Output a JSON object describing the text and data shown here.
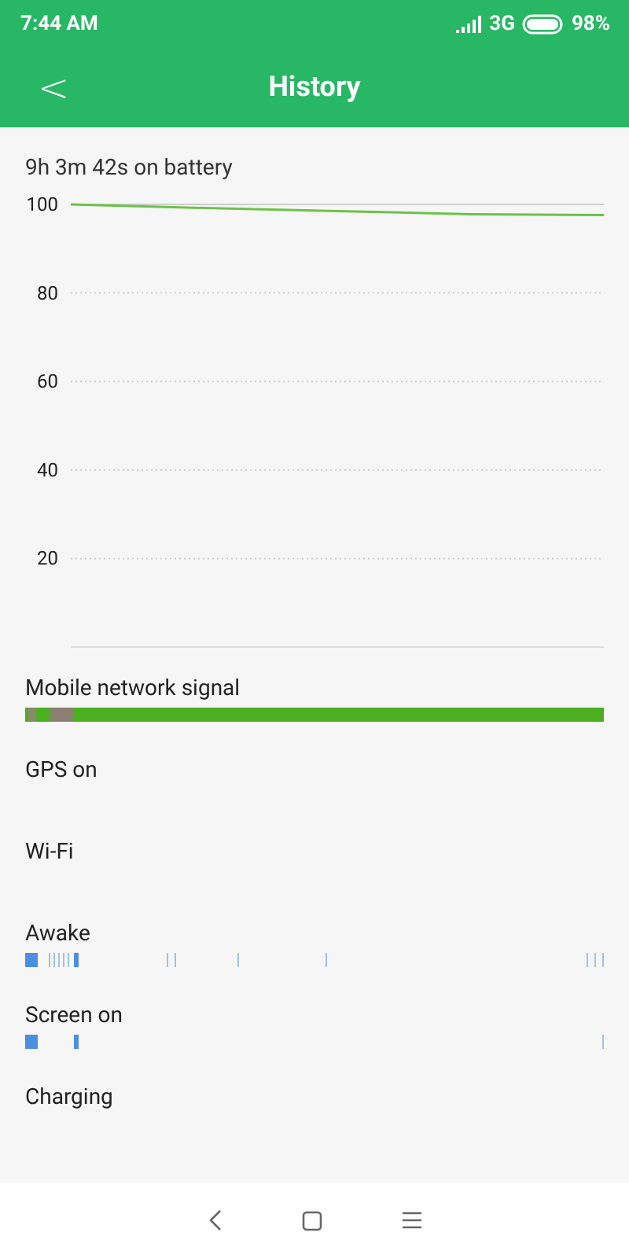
{
  "status_bar": {
    "time": "7:44 AM",
    "network": "3G",
    "battery": "98%"
  },
  "header": {
    "back": "<",
    "title": "History"
  },
  "summary": "9h 3m 42s on battery",
  "chart_data": {
    "type": "line",
    "grid": true,
    "ylim": [
      0,
      100
    ],
    "yticks": [
      100,
      80,
      60,
      40,
      20
    ],
    "series": [
      {
        "color": "#6cc24a",
        "values": [
          100,
          99.2,
          98.5,
          97.8,
          97.6
        ]
      }
    ]
  },
  "rows": [
    {
      "label": "Mobile network signal",
      "kind": "signal"
    },
    {
      "label": "GPS on",
      "kind": "empty"
    },
    {
      "label": "Wi-Fi",
      "kind": "empty"
    },
    {
      "label": "Awake",
      "kind": "awake"
    },
    {
      "label": "Screen on",
      "kind": "screen"
    },
    {
      "label": "Charging",
      "kind": "empty"
    }
  ]
}
